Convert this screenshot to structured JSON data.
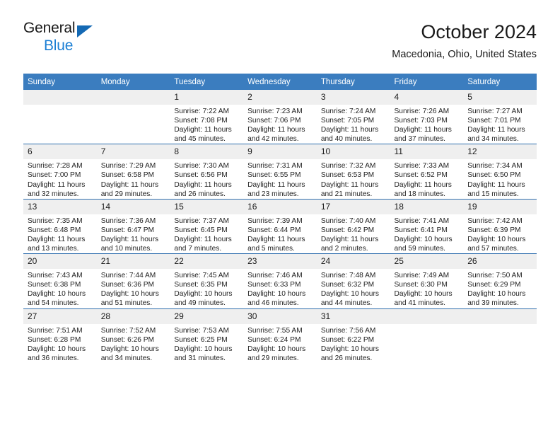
{
  "brand": {
    "name_part1": "General",
    "name_part2": "Blue",
    "accent_color": "#1b7fd4",
    "triangle_color": "#1469b4"
  },
  "header": {
    "title": "October 2024",
    "subtitle": "Macedonia, Ohio, United States"
  },
  "theme": {
    "header_row_bg": "#3b7dbf",
    "daynum_bg": "#efefef",
    "row_border": "#2f6fae"
  },
  "weekdays": [
    "Sunday",
    "Monday",
    "Tuesday",
    "Wednesday",
    "Thursday",
    "Friday",
    "Saturday"
  ],
  "labels": {
    "sunrise": "Sunrise:",
    "sunset": "Sunset:",
    "daylight": "Daylight:"
  },
  "weeks": [
    [
      {
        "day": "",
        "empty": true
      },
      {
        "day": "",
        "empty": true
      },
      {
        "day": "1",
        "sunrise": "Sunrise: 7:22 AM",
        "sunset": "Sunset: 7:08 PM",
        "daylight_line1": "Daylight: 11 hours",
        "daylight_line2": "and 45 minutes."
      },
      {
        "day": "2",
        "sunrise": "Sunrise: 7:23 AM",
        "sunset": "Sunset: 7:06 PM",
        "daylight_line1": "Daylight: 11 hours",
        "daylight_line2": "and 42 minutes."
      },
      {
        "day": "3",
        "sunrise": "Sunrise: 7:24 AM",
        "sunset": "Sunset: 7:05 PM",
        "daylight_line1": "Daylight: 11 hours",
        "daylight_line2": "and 40 minutes."
      },
      {
        "day": "4",
        "sunrise": "Sunrise: 7:26 AM",
        "sunset": "Sunset: 7:03 PM",
        "daylight_line1": "Daylight: 11 hours",
        "daylight_line2": "and 37 minutes."
      },
      {
        "day": "5",
        "sunrise": "Sunrise: 7:27 AM",
        "sunset": "Sunset: 7:01 PM",
        "daylight_line1": "Daylight: 11 hours",
        "daylight_line2": "and 34 minutes."
      }
    ],
    [
      {
        "day": "6",
        "sunrise": "Sunrise: 7:28 AM",
        "sunset": "Sunset: 7:00 PM",
        "daylight_line1": "Daylight: 11 hours",
        "daylight_line2": "and 32 minutes."
      },
      {
        "day": "7",
        "sunrise": "Sunrise: 7:29 AM",
        "sunset": "Sunset: 6:58 PM",
        "daylight_line1": "Daylight: 11 hours",
        "daylight_line2": "and 29 minutes."
      },
      {
        "day": "8",
        "sunrise": "Sunrise: 7:30 AM",
        "sunset": "Sunset: 6:56 PM",
        "daylight_line1": "Daylight: 11 hours",
        "daylight_line2": "and 26 minutes."
      },
      {
        "day": "9",
        "sunrise": "Sunrise: 7:31 AM",
        "sunset": "Sunset: 6:55 PM",
        "daylight_line1": "Daylight: 11 hours",
        "daylight_line2": "and 23 minutes."
      },
      {
        "day": "10",
        "sunrise": "Sunrise: 7:32 AM",
        "sunset": "Sunset: 6:53 PM",
        "daylight_line1": "Daylight: 11 hours",
        "daylight_line2": "and 21 minutes."
      },
      {
        "day": "11",
        "sunrise": "Sunrise: 7:33 AM",
        "sunset": "Sunset: 6:52 PM",
        "daylight_line1": "Daylight: 11 hours",
        "daylight_line2": "and 18 minutes."
      },
      {
        "day": "12",
        "sunrise": "Sunrise: 7:34 AM",
        "sunset": "Sunset: 6:50 PM",
        "daylight_line1": "Daylight: 11 hours",
        "daylight_line2": "and 15 minutes."
      }
    ],
    [
      {
        "day": "13",
        "sunrise": "Sunrise: 7:35 AM",
        "sunset": "Sunset: 6:48 PM",
        "daylight_line1": "Daylight: 11 hours",
        "daylight_line2": "and 13 minutes."
      },
      {
        "day": "14",
        "sunrise": "Sunrise: 7:36 AM",
        "sunset": "Sunset: 6:47 PM",
        "daylight_line1": "Daylight: 11 hours",
        "daylight_line2": "and 10 minutes."
      },
      {
        "day": "15",
        "sunrise": "Sunrise: 7:37 AM",
        "sunset": "Sunset: 6:45 PM",
        "daylight_line1": "Daylight: 11 hours",
        "daylight_line2": "and 7 minutes."
      },
      {
        "day": "16",
        "sunrise": "Sunrise: 7:39 AM",
        "sunset": "Sunset: 6:44 PM",
        "daylight_line1": "Daylight: 11 hours",
        "daylight_line2": "and 5 minutes."
      },
      {
        "day": "17",
        "sunrise": "Sunrise: 7:40 AM",
        "sunset": "Sunset: 6:42 PM",
        "daylight_line1": "Daylight: 11 hours",
        "daylight_line2": "and 2 minutes."
      },
      {
        "day": "18",
        "sunrise": "Sunrise: 7:41 AM",
        "sunset": "Sunset: 6:41 PM",
        "daylight_line1": "Daylight: 10 hours",
        "daylight_line2": "and 59 minutes."
      },
      {
        "day": "19",
        "sunrise": "Sunrise: 7:42 AM",
        "sunset": "Sunset: 6:39 PM",
        "daylight_line1": "Daylight: 10 hours",
        "daylight_line2": "and 57 minutes."
      }
    ],
    [
      {
        "day": "20",
        "sunrise": "Sunrise: 7:43 AM",
        "sunset": "Sunset: 6:38 PM",
        "daylight_line1": "Daylight: 10 hours",
        "daylight_line2": "and 54 minutes."
      },
      {
        "day": "21",
        "sunrise": "Sunrise: 7:44 AM",
        "sunset": "Sunset: 6:36 PM",
        "daylight_line1": "Daylight: 10 hours",
        "daylight_line2": "and 51 minutes."
      },
      {
        "day": "22",
        "sunrise": "Sunrise: 7:45 AM",
        "sunset": "Sunset: 6:35 PM",
        "daylight_line1": "Daylight: 10 hours",
        "daylight_line2": "and 49 minutes."
      },
      {
        "day": "23",
        "sunrise": "Sunrise: 7:46 AM",
        "sunset": "Sunset: 6:33 PM",
        "daylight_line1": "Daylight: 10 hours",
        "daylight_line2": "and 46 minutes."
      },
      {
        "day": "24",
        "sunrise": "Sunrise: 7:48 AM",
        "sunset": "Sunset: 6:32 PM",
        "daylight_line1": "Daylight: 10 hours",
        "daylight_line2": "and 44 minutes."
      },
      {
        "day": "25",
        "sunrise": "Sunrise: 7:49 AM",
        "sunset": "Sunset: 6:30 PM",
        "daylight_line1": "Daylight: 10 hours",
        "daylight_line2": "and 41 minutes."
      },
      {
        "day": "26",
        "sunrise": "Sunrise: 7:50 AM",
        "sunset": "Sunset: 6:29 PM",
        "daylight_line1": "Daylight: 10 hours",
        "daylight_line2": "and 39 minutes."
      }
    ],
    [
      {
        "day": "27",
        "sunrise": "Sunrise: 7:51 AM",
        "sunset": "Sunset: 6:28 PM",
        "daylight_line1": "Daylight: 10 hours",
        "daylight_line2": "and 36 minutes."
      },
      {
        "day": "28",
        "sunrise": "Sunrise: 7:52 AM",
        "sunset": "Sunset: 6:26 PM",
        "daylight_line1": "Daylight: 10 hours",
        "daylight_line2": "and 34 minutes."
      },
      {
        "day": "29",
        "sunrise": "Sunrise: 7:53 AM",
        "sunset": "Sunset: 6:25 PM",
        "daylight_line1": "Daylight: 10 hours",
        "daylight_line2": "and 31 minutes."
      },
      {
        "day": "30",
        "sunrise": "Sunrise: 7:55 AM",
        "sunset": "Sunset: 6:24 PM",
        "daylight_line1": "Daylight: 10 hours",
        "daylight_line2": "and 29 minutes."
      },
      {
        "day": "31",
        "sunrise": "Sunrise: 7:56 AM",
        "sunset": "Sunset: 6:22 PM",
        "daylight_line1": "Daylight: 10 hours",
        "daylight_line2": "and 26 minutes."
      },
      {
        "day": "",
        "empty": true
      },
      {
        "day": "",
        "empty": true
      }
    ]
  ]
}
